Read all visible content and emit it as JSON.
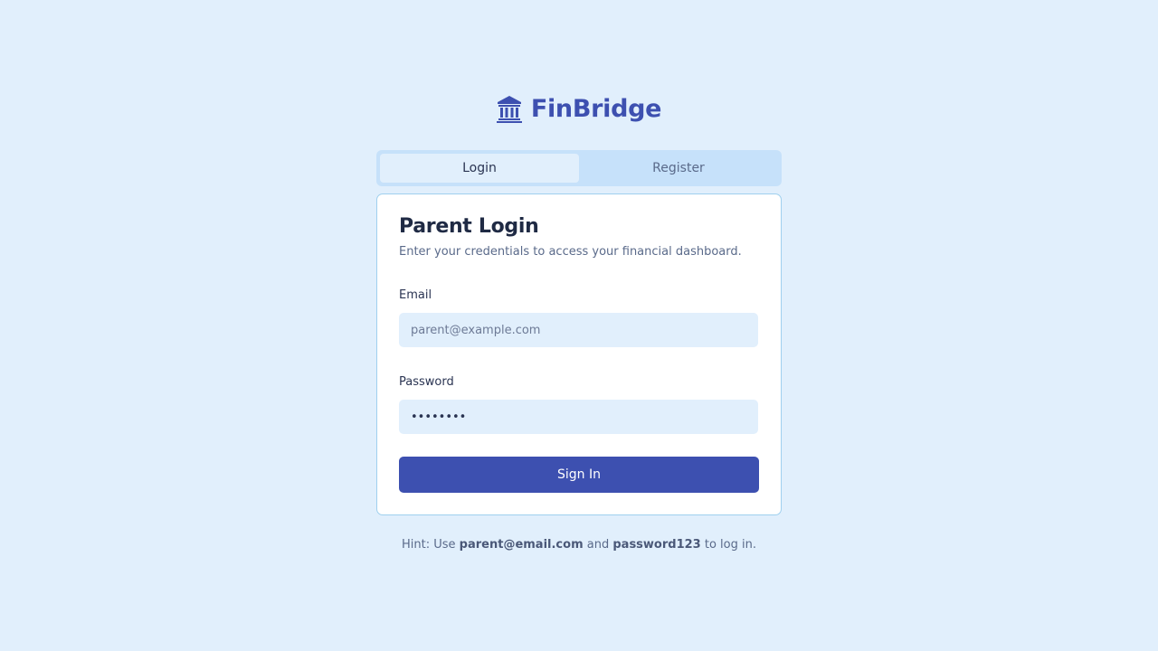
{
  "brand": {
    "name": "FinBridge",
    "icon": "bank-icon",
    "color": "#3d50b0"
  },
  "tabs": [
    {
      "label": "Login",
      "active": true
    },
    {
      "label": "Register",
      "active": false
    }
  ],
  "card": {
    "title": "Parent Login",
    "subtitle": "Enter your credentials to access your financial dashboard."
  },
  "form": {
    "email": {
      "label": "Email",
      "value": "",
      "placeholder": "parent@example.com"
    },
    "password": {
      "label": "Password",
      "value": "password",
      "placeholder": ""
    },
    "submit_label": "Sign In"
  },
  "hint": {
    "prefix": "Hint: Use ",
    "email": "parent@email.com",
    "middle": " and ",
    "password": "password123",
    "suffix": " to log in."
  },
  "colors": {
    "background": "#e1effc",
    "accent": "#3d50b0",
    "card_border": "#9fd0ee",
    "tab_track": "#c6e1fa"
  }
}
